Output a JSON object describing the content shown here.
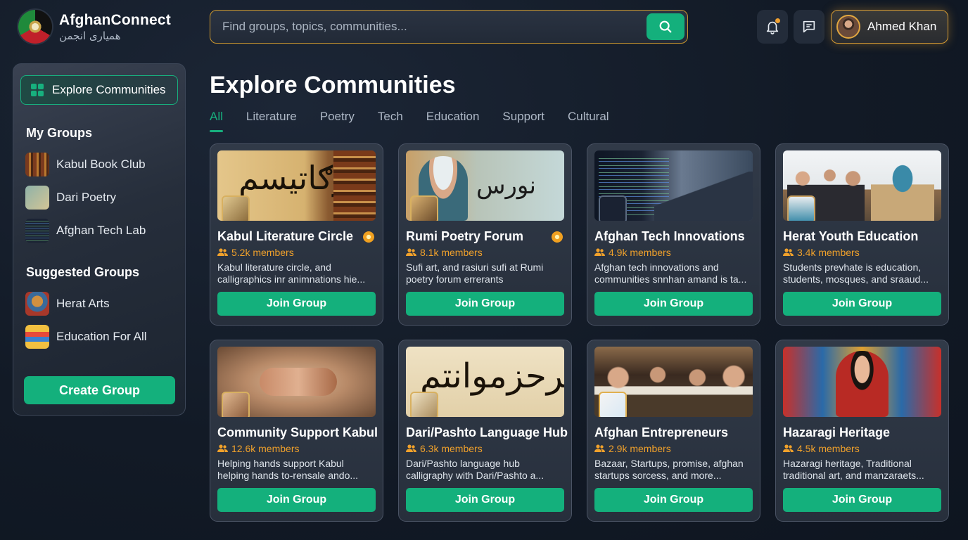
{
  "app": {
    "title": "AfghanConnect",
    "subtitle": "همیاری انجمن"
  },
  "search": {
    "placeholder": "Find groups, topics, communities..."
  },
  "user": {
    "name": "Ahmed Khan",
    "has_notifications": true
  },
  "sidebar": {
    "explore_label": "Explore Communities",
    "my_groups_title": "My Groups",
    "my_groups": [
      {
        "label": "Kabul Book Club",
        "icon": "book-club-thumbnail"
      },
      {
        "label": "Dari Poetry",
        "icon": "poetry-thumbnail"
      },
      {
        "label": "Afghan Tech Lab",
        "icon": "tech-thumbnail"
      }
    ],
    "suggested_title": "Suggested Groups",
    "suggested": [
      {
        "label": "Herat Arts",
        "icon": "herat-arts-thumbnail"
      },
      {
        "label": "Education For All",
        "icon": "books-thumbnail"
      }
    ],
    "create_label": "Create Group"
  },
  "main": {
    "title": "Explore Communities",
    "tabs": [
      "All",
      "Literature",
      "Poetry",
      "Tech",
      "Education",
      "Support",
      "Cultural"
    ],
    "active_tab": "All",
    "cards": [
      {
        "name": "Kabul Literature Circle",
        "members": "5.2k members",
        "desc": "Kabul literature circle, and calligraphics inr animnations hie...",
        "featured": true
      },
      {
        "name": "Rumi Poetry Forum",
        "members": "8.1k members",
        "desc": "Sufi art, and rasiuri sufi at Rumi poetry forum errerants",
        "featured": true
      },
      {
        "name": "Afghan Tech Innovations",
        "members": "4.9k members",
        "desc": "Afghan tech innovations and communities snnhan amand is ta...",
        "featured": false
      },
      {
        "name": "Herat Youth Education",
        "members": "3.4k members",
        "desc": "Students prevhate is education, students, mosques, and sraaud...",
        "featured": false
      },
      {
        "name": "Community Support Kabul",
        "members": "12.6k members",
        "desc": "Helping hands support Kabul helping hands to-rensale ando...",
        "featured": false
      },
      {
        "name": "Dari/Pashto Language Hub",
        "members": "6.3k members",
        "desc": "Dari/Pashto language hub calligraphy with Dari/Pashto a...",
        "featured": false
      },
      {
        "name": "Afghan Entrepreneurs",
        "members": "2.9k members",
        "desc": "Bazaar, Startups, promise, afghan startups sorcess, and more...",
        "featured": false
      },
      {
        "name": "Hazaragi Heritage",
        "members": "4.5k members",
        "desc": "Hazaragi heritage, Traditional traditional art, and manzaraets...",
        "featured": false
      }
    ],
    "join_label": "Join Group"
  },
  "colors": {
    "accent": "#14b07c",
    "highlight": "#f0a12b",
    "background": "#121a26"
  }
}
